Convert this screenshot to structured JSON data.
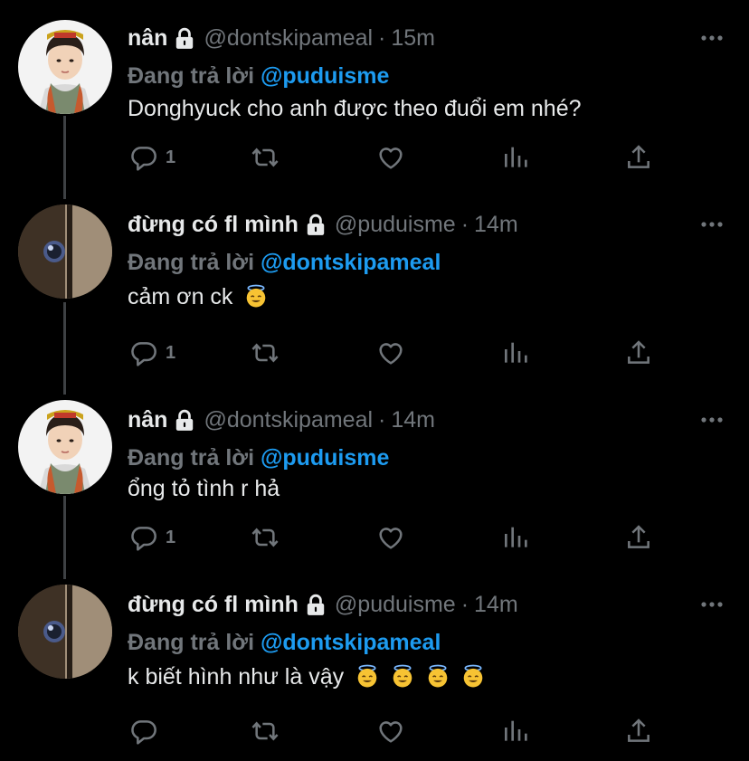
{
  "tweets": [
    {
      "name": "nân",
      "handle": "@dontskipameal",
      "time": "15m",
      "replying_label": "Đang trả lời",
      "replying_to": "@puduisme",
      "text": "Donghyuck cho anh được theo đuổi em nhé?",
      "emoji_count": 0,
      "reply_count": "1",
      "avatar": "boy-avatar"
    },
    {
      "name": "đừng có fl mình",
      "handle": "@puduisme",
      "time": "14m",
      "replying_label": "Đang trả lời",
      "replying_to": "@dontskipameal",
      "text": "cảm ơn ck",
      "emoji_count": 1,
      "reply_count": "1",
      "avatar": "doorknob-avatar"
    },
    {
      "name": "nân",
      "handle": "@dontskipameal",
      "time": "14m",
      "replying_label": "Đang trả lời",
      "replying_to": "@puduisme",
      "text": "ổng tỏ tình r hả",
      "emoji_count": 0,
      "reply_count": "1",
      "avatar": "boy-avatar"
    },
    {
      "name": "đừng có fl mình",
      "handle": "@puduisme",
      "time": "14m",
      "replying_label": "Đang trả lời",
      "replying_to": "@dontskipameal",
      "text": "k biết hình như là vậy",
      "emoji_count": 4,
      "reply_count": "",
      "avatar": "doorknob-avatar"
    }
  ],
  "icons": {
    "more": "more-horizontal-icon",
    "lock": "lock-icon",
    "reply": "reply-icon",
    "retweet": "retweet-icon",
    "like": "heart-icon",
    "views": "analytics-icon",
    "share": "share-icon",
    "emoji": "smiling-face-with-halo-emoji"
  },
  "colors": {
    "background": "#000000",
    "text": "#e7e9ea",
    "muted": "#71767b",
    "accent": "#1d9bf0",
    "thread_line": "#3e4144"
  }
}
